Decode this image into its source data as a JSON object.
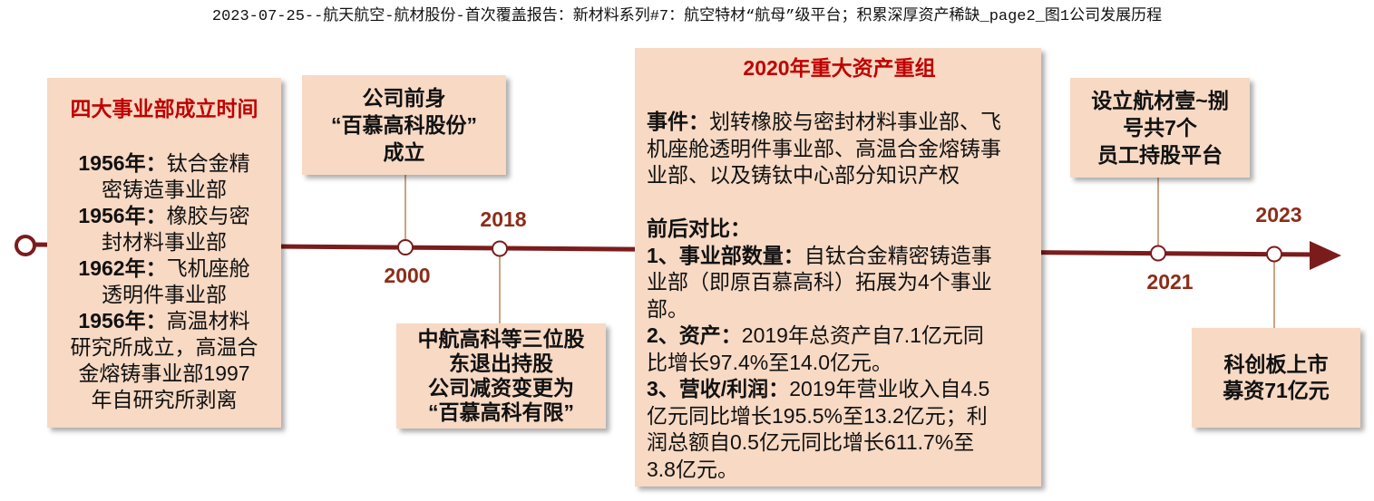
{
  "header": {
    "title": "2023-07-25--航天航空-航材股份-首次覆盖报告：新材料系列#7：航空特材“航母”级平台；积累深厚资产稀缺_page2_图1公司发展历程"
  },
  "colors": {
    "timeline": "#7b1c1c",
    "year_label": "#8c2d19",
    "highlight_title": "#c00000",
    "box_fill": "#f7d9c4",
    "connector": "#c08358"
  },
  "timeline": {
    "years": [
      "2000",
      "2018",
      "2021",
      "2023"
    ]
  },
  "business_units_box": {
    "title": "四大事业部成立时间",
    "entries": [
      {
        "year": "1956年：",
        "lines": [
          "钛合金精",
          "密铸造事业部"
        ]
      },
      {
        "year": "1956年：",
        "lines": [
          "橡胶与密",
          "封材料事业部"
        ]
      },
      {
        "year": "1962年：",
        "lines": [
          "飞机座舱",
          "透明件事业部"
        ]
      },
      {
        "year": "1956年：",
        "lines": [
          "高温材料",
          "研究所成立，高温合",
          "金熔铸事业部1997",
          "年自研究所剥离"
        ]
      }
    ]
  },
  "predecessor_box": {
    "lines": [
      "公司前身",
      "“百慕高科股份”",
      "成立"
    ]
  },
  "shareholder_exit_box": {
    "lines": [
      "中航高科等三位股",
      "东退出持股",
      "公司减资变更为",
      "“百慕高科有限”"
    ]
  },
  "restructuring_box": {
    "title": "2020年重大资产重组",
    "event": {
      "label": "事件：",
      "lines": [
        "划转橡胶与密封材料事业部、飞",
        "机座舱透明件事业部、高温合金熔铸事",
        "业部、以及铸钛中心部分知识产权"
      ]
    },
    "comparison_heading": "前后对比：",
    "items": [
      {
        "label": "1、事业部数量：",
        "lines": [
          "自钛合金精密铸造事",
          "业部（即原百慕高科）拓展为4个事业",
          "部。"
        ]
      },
      {
        "label": "2、资产：",
        "lines": [
          "2019年总资产自7.1亿元同",
          "比增长97.4%至14.0亿元。"
        ]
      },
      {
        "label": "3、营收/利润：",
        "lines": [
          "2019年营业收入自4.5",
          "亿元同比增长195.5%至13.2亿元；利",
          "润总额自0.5亿元同比增长611.7%至",
          "3.8亿元。"
        ]
      }
    ]
  },
  "esop_box": {
    "lines": [
      "设立航材壹~捌",
      "号共7个",
      "员工持股平台"
    ]
  },
  "ipo_box": {
    "lines": [
      "科创板上市",
      "募资71亿元"
    ]
  }
}
